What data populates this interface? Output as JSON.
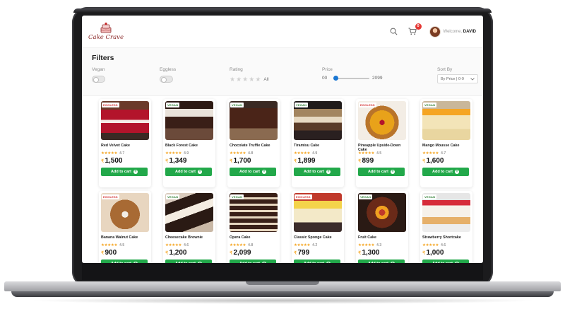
{
  "app": {
    "logo_text": "Cake Crave",
    "cart_count": "0",
    "welcome_prefix": "Welcome,",
    "user_name": "DAVID",
    "accent_color": "#22a84a",
    "star_color": "#f5a623"
  },
  "filters": {
    "title": "Filters",
    "vegan_label": "Vegan",
    "eggless_label": "Eggless",
    "rating_label": "Rating",
    "rating_all": "All",
    "price_label": "Price",
    "price_min": "00",
    "price_max": "2099",
    "sort_label": "Sort By",
    "sort_value": "By Price | 0-9"
  },
  "products": [
    {
      "tag": "EGGLESS",
      "name": "Red Velvet Cake",
      "stars": "★★★★★",
      "rating": "4.7",
      "currency": "₹",
      "price": "1,500",
      "button": "Add to cart"
    },
    {
      "tag": "VEGAN",
      "name": "Black Forest Cake",
      "stars": "★★★★★",
      "rating": "4.9",
      "currency": "₹",
      "price": "1,349",
      "button": "Add to cart"
    },
    {
      "tag": "VEGAN",
      "name": "Chocolate Truffle Cake",
      "stars": "★★★★★",
      "rating": "4.8",
      "currency": "₹",
      "price": "1,700",
      "button": "Add to cart"
    },
    {
      "tag": "VEGAN",
      "name": "Tiramisu Cake",
      "stars": "★★★★★",
      "rating": "4.9",
      "currency": "₹",
      "price": "1,899",
      "button": "Add to cart"
    },
    {
      "tag": "EGGLESS",
      "name": "Pineapple Upside-Down Cake",
      "stars": "★★★★★",
      "rating": "4.5",
      "currency": "₹",
      "price": "899",
      "button": "Add to cart"
    },
    {
      "tag": "VEGAN",
      "name": "Mango Mousse Cake",
      "stars": "★★★★★",
      "rating": "4.7",
      "currency": "₹",
      "price": "1,600",
      "button": "Add to cart"
    },
    {
      "tag": "EGGLESS",
      "name": "Banana Walnut Cake",
      "stars": "★★★★★",
      "rating": "4.5",
      "currency": "₹",
      "price": "900",
      "button": "Add to cart"
    },
    {
      "tag": "VEGAN",
      "name": "Cheesecake Brownie",
      "stars": "★★★★★",
      "rating": "4.6",
      "currency": "₹",
      "price": "1,200",
      "button": "Add to cart"
    },
    {
      "tag": "VEGAN",
      "name": "Opera Cake",
      "stars": "★★★★★",
      "rating": "4.8",
      "currency": "₹",
      "price": "2,099",
      "button": "Add to cart"
    },
    {
      "tag": "EGGLESS",
      "name": "Classic Sponge Cake",
      "stars": "★★★★★",
      "rating": "4.2",
      "currency": "₹",
      "price": "799",
      "button": "Add to cart"
    },
    {
      "tag": "VEGAN",
      "name": "Fruit Cake",
      "stars": "★★★★★",
      "rating": "4.3",
      "currency": "₹",
      "price": "1,300",
      "button": "Add to cart"
    },
    {
      "tag": "VEGAN",
      "name": "Strawberry Shortcake",
      "stars": "★★★★★",
      "rating": "4.6",
      "currency": "₹",
      "price": "1,000",
      "button": "Add to cart"
    }
  ]
}
